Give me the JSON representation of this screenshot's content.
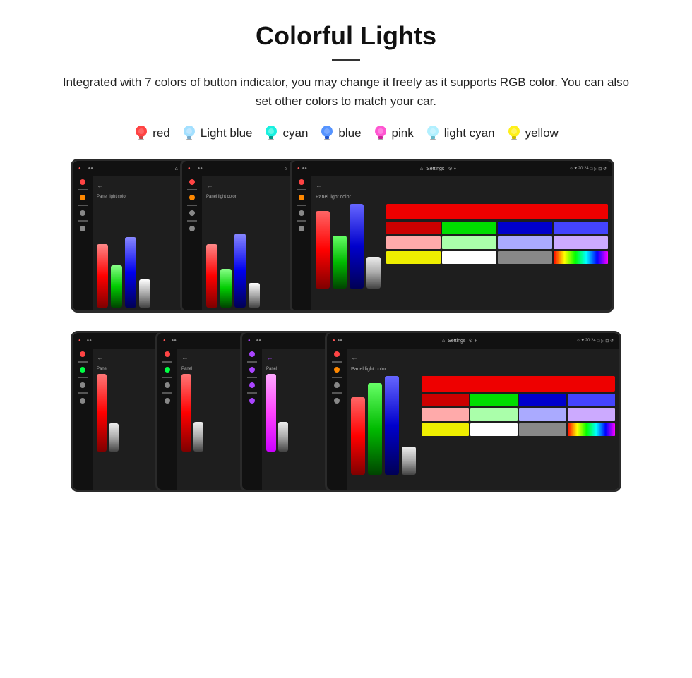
{
  "page": {
    "title": "Colorful Lights",
    "description": "Integrated with 7 colors of button indicator, you may change it freely as it supports RGB color. You can also set other colors to match your car.",
    "colors": [
      {
        "name": "red",
        "color": "#ff2222",
        "bulb_color": "#ff2222"
      },
      {
        "name": "Light blue",
        "color": "#66ccff",
        "bulb_color": "#66ccff"
      },
      {
        "name": "cyan",
        "color": "#00ffee",
        "bulb_color": "#00ffee"
      },
      {
        "name": "blue",
        "color": "#4488ff",
        "bulb_color": "#4488ff"
      },
      {
        "name": "pink",
        "color": "#ff44cc",
        "bulb_color": "#ff44cc"
      },
      {
        "name": "light cyan",
        "color": "#aaeeff",
        "bulb_color": "#aaeeff"
      },
      {
        "name": "yellow",
        "color": "#ffee00",
        "bulb_color": "#ffee00"
      }
    ],
    "watermark": "Seicane",
    "panel_label": "Panel light color",
    "settings_label": "Settings"
  }
}
